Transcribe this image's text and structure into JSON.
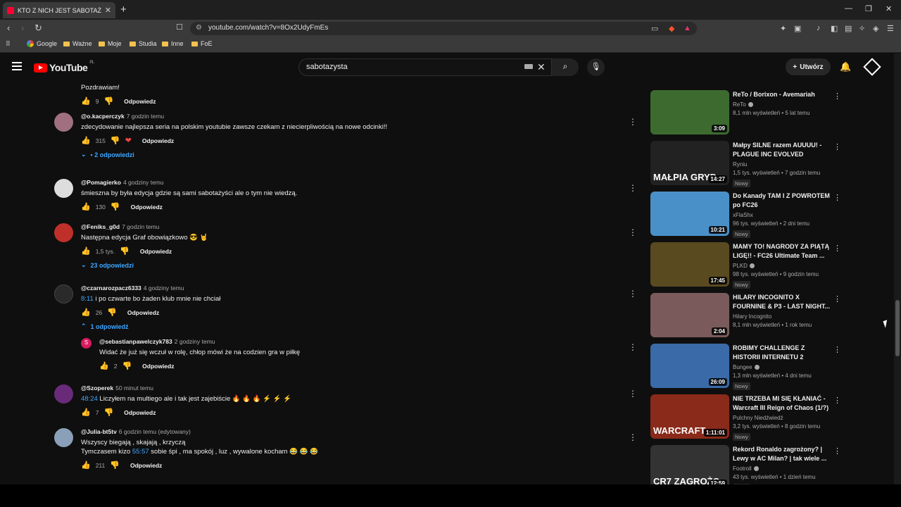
{
  "browser": {
    "tab_title": "KTO Z NICH JEST SABOTAŻYS",
    "url": "youtube.com/watch?v=8Ox2UdyFmEs",
    "bookmarks": [
      "Google",
      "Ważne",
      "Moje",
      "Studia",
      "Inne",
      "FoE"
    ]
  },
  "youtube": {
    "logo": "YouTube",
    "region": "PL",
    "search_value": "sabotazysta",
    "create_label": "Utwórz"
  },
  "comments": [
    {
      "user": "",
      "time": "",
      "text": "Pozdrawiam!",
      "likes": "9",
      "reply_label": "Odpowiedz"
    },
    {
      "user": "@o.kacperczyk",
      "time": "7 godzin temu",
      "text": "zdecydowanie najlepsza seria na polskim youtubie zawsze czekam z niecierpliwością na nowe odcinki!!",
      "likes": "315",
      "reply_label": "Odpowiedz",
      "replies": "• 2 odpowiedzi"
    },
    {
      "user": "@Pomagierko",
      "time": "4 godziny temu",
      "text": "śmieszna by była edycja gdzie są sami sabotażyści ale o tym nie wiedzą.",
      "likes": "130",
      "reply_label": "Odpowiedz"
    },
    {
      "user": "@Feniks_g0d",
      "time": "7 godzin temu",
      "text": "Następna edycja Graf obowiązkowo 😎 🤘",
      "likes": "1,5 tys.",
      "reply_label": "Odpowiedz",
      "replies": "23 odpowiedzi"
    },
    {
      "user": "@czarnarozpacz6333",
      "time": "4 godziny temu",
      "ts": "8:11",
      "text": " i po czwarte bo żaden klub mnie nie chciał",
      "likes": "26",
      "reply_label": "Odpowiedz",
      "replies": "1 odpowiedź"
    },
    {
      "user": "@sebastianpawelczyk783",
      "time": "2 godziny temu",
      "text": "Widać że już się wczuł w rolę, chłop mówi że na codzien gra w piłkę",
      "likes": "2",
      "reply_label": "Odpowiedz",
      "avatar_letter": "S"
    },
    {
      "user": "@Szoperek",
      "time": "50 minut temu",
      "ts": "48:24",
      "text": " Liczyłem na multiego ale i tak jest zajebiście 🔥 🔥 🔥 ⚡ ⚡ ⚡",
      "likes": "7",
      "reply_label": "Odpowiedz"
    },
    {
      "user": "@Julia-bt5tv",
      "time": "6 godzin temu (edytowany)",
      "text": "Wszyscy biegają , skajają , krzyczą",
      "text2_pre": "Tymczasem kizo ",
      "ts": "55:57",
      "text2_post": " sobie śpi , ma  spokój  , luz , wywalone  kocham 😂 😂 😂",
      "likes": "211",
      "reply_label": "Odpowiedz"
    }
  ],
  "videos": [
    {
      "title": "ReTo / Borixon - Avemariah",
      "channel": "ReTo",
      "verified": true,
      "stats": "8,1 mln wyświetleń • 5 lat temu",
      "duration": "3:09",
      "new": "",
      "thumb_color": "#3d6b2f"
    },
    {
      "title": "Małpy SILNE razem AUUUU! - PLAGUE INC EVOLVED",
      "channel": "Ryniu",
      "verified": false,
      "stats": "1,5 tys. wyświetleń • 7 godzin temu",
      "duration": "14:27",
      "new": "Nowy",
      "thumb_color": "#222222",
      "thumb_text": "MAŁPIA GRYP"
    },
    {
      "title": "Do Kanady TAM I Z POWROTEM po FC26",
      "channel": "xFlaShx",
      "verified": false,
      "stats": "96 tys. wyświetleń • 2 dni temu",
      "duration": "10:21",
      "new": "Nowy",
      "thumb_color": "#4a90c8"
    },
    {
      "title": "MAMY TO! NAGRODY ZA PIĄTĄ LIGĘ!! - FC26 Ultimate Team ...",
      "channel": "PLKD",
      "verified": true,
      "stats": "98 tys. wyświetleń • 9 godzin temu",
      "duration": "17:45",
      "new": "Nowy",
      "thumb_color": "#5a4a20"
    },
    {
      "title": "HILARY INCOGNITO X FOURNINE & P3 - LAST NIGHT...",
      "channel": "Hilary Incognito",
      "verified": false,
      "stats": "8,1 mln wyświetleń • 1 rok temu",
      "duration": "2:04",
      "new": "",
      "thumb_color": "#7a5a5a"
    },
    {
      "title": "ROBIMY CHALLENGE Z HISTORII INTERNETU 2",
      "channel": "Bungee",
      "verified": true,
      "stats": "1,3 mln wyświetleń • 4 dni temu",
      "duration": "26:09",
      "new": "Nowy",
      "thumb_color": "#3a6aa8"
    },
    {
      "title": "NIE TRZEBA MI SIĘ KŁANIAĆ - Warcraft III Reign of Chaos (1/?)",
      "channel": "Pulchny Niedźwiedź",
      "verified": false,
      "stats": "3,2 tys. wyświetleń • 8 godzin temu",
      "duration": "1:11:01",
      "new": "Nowy",
      "thumb_color": "#8a2a1a",
      "thumb_text": "WARCRAFT"
    },
    {
      "title": "Rekord Ronaldo zagrożony? | Lewy w AC Milan? | tak wiele ...",
      "channel": "Footroll",
      "verified": true,
      "stats": "43 tys. wyświetleń • 1 dzień temu",
      "duration": "12:59",
      "new": "Nowy",
      "thumb_color": "#333333",
      "thumb_text": "CR7 ZAGROŻO"
    }
  ]
}
